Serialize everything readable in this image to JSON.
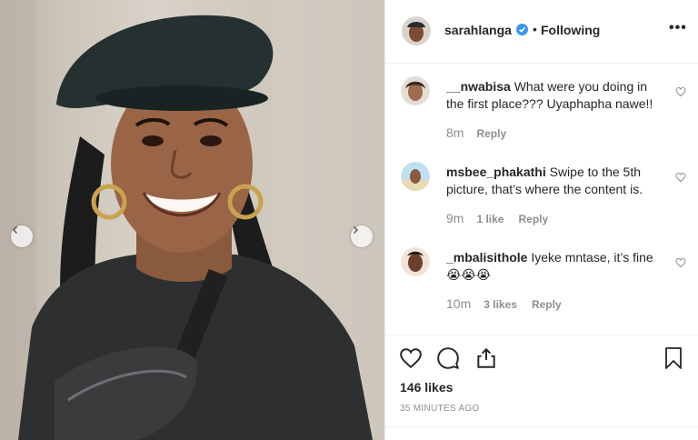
{
  "post": {
    "username": "sarahlanga",
    "dot": "•",
    "follow_label": "Following",
    "more_label": "•••"
  },
  "comments": [
    {
      "username": "__nwabisa",
      "text": "What were you doing in the first place??? Uyaphapha nawe!!",
      "time": "8m",
      "likes": "",
      "reply": "Reply"
    },
    {
      "username": "msbee_phakathi",
      "text": "Swipe to the 5th picture, that’s where the content is.",
      "time": "9m",
      "likes": "1 like",
      "reply": "Reply"
    },
    {
      "username": "_mbalisithole",
      "text": "Iyeke mntase, it’s fine 😭😭😭",
      "time": "10m",
      "likes": "3 likes",
      "reply": "Reply"
    }
  ],
  "stats": {
    "likes": "146 likes",
    "posted": "35 MINUTES AGO"
  },
  "icons": {
    "verified": "verified-badge-icon",
    "more": "more-options-icon",
    "like": "heart-icon",
    "comment": "comment-bubble-icon",
    "share": "share-icon",
    "save": "bookmark-icon",
    "prev": "chevron-left-icon",
    "next": "chevron-right-icon"
  },
  "colors": {
    "verified": "#3897f0",
    "text": "#262626",
    "muted": "#8e8e8e",
    "divider": "#efefef"
  }
}
